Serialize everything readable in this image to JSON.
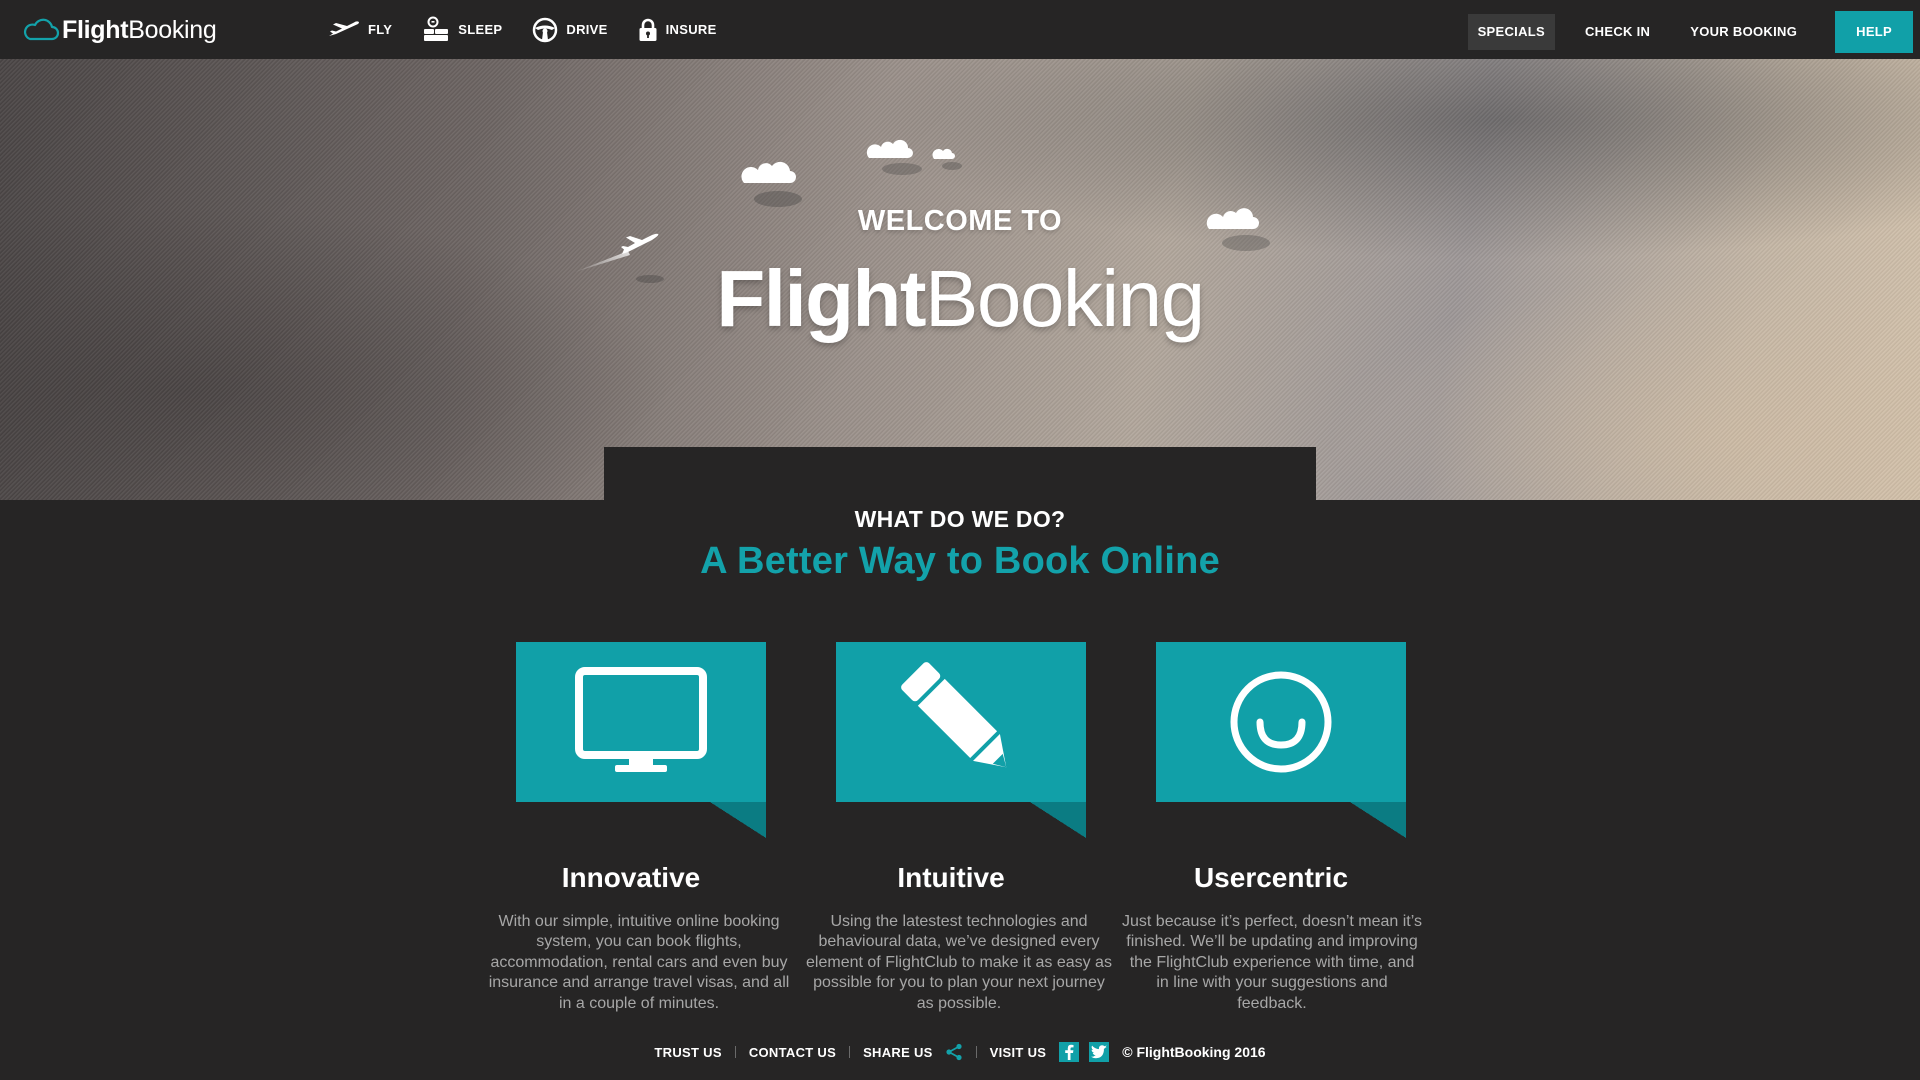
{
  "brand": {
    "name_bold": "Flight",
    "name_regular": "Booking"
  },
  "main_nav": [
    {
      "label": "FLY",
      "icon": "plane-icon"
    },
    {
      "label": "SLEEP",
      "icon": "bed-icon"
    },
    {
      "label": "DRIVE",
      "icon": "steering-wheel-icon"
    },
    {
      "label": "INSURE",
      "icon": "lock-icon"
    }
  ],
  "right_nav": {
    "specials": "SPECIALS",
    "check_in": "CHECK IN",
    "your_booking": "YOUR BOOKING",
    "help": "HELP"
  },
  "hero": {
    "welcome": "WELCOME TO",
    "brand_bold": "Flight",
    "brand_regular": "Booking"
  },
  "section": {
    "eyebrow": "WHAT DO WE DO?",
    "title": "A Better Way to Book Online"
  },
  "features": [
    {
      "title": "Innovative",
      "icon": "monitor-icon",
      "text": "With our simple, intuitive online booking system, you can book flights, accommodation, rental cars and even buy insurance and arrange travel visas, and all in a couple of minutes."
    },
    {
      "title": "Intuitive",
      "icon": "pencil-icon",
      "text": "Using the latestest technologies and behavioural data, we’ve designed every element of FlightClub to make it as easy as possible for you to plan your next journey as possible."
    },
    {
      "title": "Usercentric",
      "icon": "smiley-icon",
      "text": "Just because it’s perfect, doesn’t mean it’s finished. We’ll be updating and improving the FlightClub experience with time, and in line with your suggestions and feedback."
    }
  ],
  "footer": {
    "trust_us": "TRUST US",
    "contact_us": "CONTACT US",
    "share_us": "SHARE US",
    "visit_us": "VISIT US",
    "copyright": "© FlightBooking 2016"
  },
  "colors": {
    "accent": "#11a0a8",
    "accent_dark": "#0b7c83",
    "background": "#262525"
  }
}
